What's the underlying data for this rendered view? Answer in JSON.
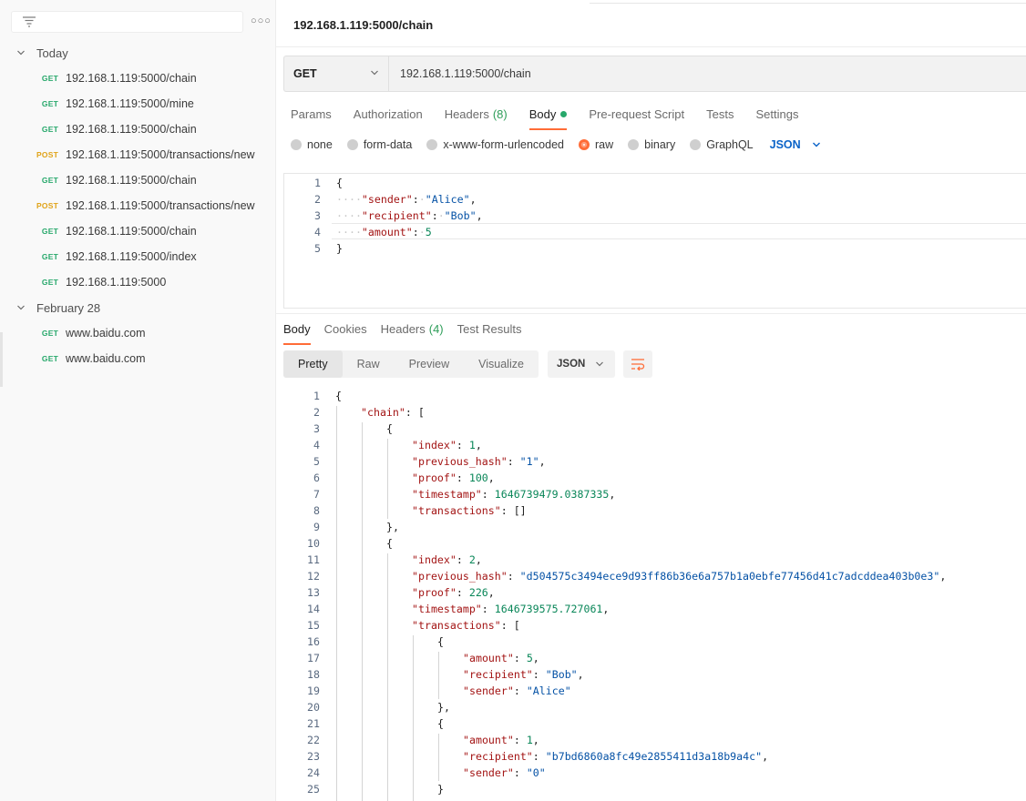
{
  "sidebar": {
    "groups": [
      {
        "label": "Today",
        "items": [
          {
            "method": "GET",
            "url": "192.168.1.119:5000/chain"
          },
          {
            "method": "GET",
            "url": "192.168.1.119:5000/mine"
          },
          {
            "method": "GET",
            "url": "192.168.1.119:5000/chain"
          },
          {
            "method": "POST",
            "url": "192.168.1.119:5000/transactions/new"
          },
          {
            "method": "GET",
            "url": "192.168.1.119:5000/chain"
          },
          {
            "method": "POST",
            "url": "192.168.1.119:5000/transactions/new"
          },
          {
            "method": "GET",
            "url": "192.168.1.119:5000/chain"
          },
          {
            "method": "GET",
            "url": "192.168.1.119:5000/index"
          },
          {
            "method": "GET",
            "url": "192.168.1.119:5000"
          }
        ]
      },
      {
        "label": "February 28",
        "items": [
          {
            "method": "GET",
            "url": "www.baidu.com"
          },
          {
            "method": "GET",
            "url": "www.baidu.com"
          }
        ]
      }
    ]
  },
  "request": {
    "title": "192.168.1.119:5000/chain",
    "method": "GET",
    "url": "192.168.1.119:5000/chain",
    "tabs": [
      {
        "label": "Params"
      },
      {
        "label": "Authorization"
      },
      {
        "label": "Headers",
        "count": "(8)"
      },
      {
        "label": "Body",
        "active": true,
        "dot": true
      },
      {
        "label": "Pre-request Script"
      },
      {
        "label": "Tests"
      },
      {
        "label": "Settings"
      }
    ],
    "body_types": [
      {
        "label": "none"
      },
      {
        "label": "form-data"
      },
      {
        "label": "x-www-form-urlencoded"
      },
      {
        "label": "raw",
        "selected": true
      },
      {
        "label": "binary"
      },
      {
        "label": "GraphQL"
      }
    ],
    "raw_format": "JSON",
    "body_lines": [
      [
        [
          "p",
          "{"
        ]
      ],
      [
        [
          "w",
          "····"
        ],
        [
          "k",
          "\"sender\""
        ],
        [
          "p",
          ":"
        ],
        [
          "w",
          "·"
        ],
        [
          "s",
          "\"Alice\""
        ],
        [
          "p",
          ","
        ]
      ],
      [
        [
          "w",
          "····"
        ],
        [
          "k",
          "\"recipient\""
        ],
        [
          "p",
          ":"
        ],
        [
          "w",
          "·"
        ],
        [
          "s",
          "\"Bob\""
        ],
        [
          "p",
          ","
        ]
      ],
      [
        [
          "w",
          "····"
        ],
        [
          "k",
          "\"amount\""
        ],
        [
          "p",
          ":"
        ],
        [
          "w",
          "·"
        ],
        [
          "n",
          "5"
        ]
      ],
      [
        [
          "p",
          "}"
        ]
      ]
    ]
  },
  "response": {
    "tabs": [
      {
        "label": "Body",
        "active": true
      },
      {
        "label": "Cookies"
      },
      {
        "label": "Headers",
        "count": "(4)"
      },
      {
        "label": "Test Results"
      }
    ],
    "views": [
      {
        "label": "Pretty",
        "active": true
      },
      {
        "label": "Raw"
      },
      {
        "label": "Preview"
      },
      {
        "label": "Visualize"
      }
    ],
    "format": "JSON",
    "lines": [
      {
        "indent": 0,
        "parts": [
          [
            "p",
            "{"
          ]
        ]
      },
      {
        "indent": 1,
        "parts": [
          [
            "k",
            "\"chain\""
          ],
          [
            "p",
            ": ["
          ]
        ]
      },
      {
        "indent": 2,
        "parts": [
          [
            "p",
            "{"
          ]
        ]
      },
      {
        "indent": 3,
        "parts": [
          [
            "k",
            "\"index\""
          ],
          [
            "p",
            ": "
          ],
          [
            "n",
            "1"
          ],
          [
            "p",
            ","
          ]
        ]
      },
      {
        "indent": 3,
        "parts": [
          [
            "k",
            "\"previous_hash\""
          ],
          [
            "p",
            ": "
          ],
          [
            "s",
            "\"1\""
          ],
          [
            "p",
            ","
          ]
        ]
      },
      {
        "indent": 3,
        "parts": [
          [
            "k",
            "\"proof\""
          ],
          [
            "p",
            ": "
          ],
          [
            "n",
            "100"
          ],
          [
            "p",
            ","
          ]
        ]
      },
      {
        "indent": 3,
        "parts": [
          [
            "k",
            "\"timestamp\""
          ],
          [
            "p",
            ": "
          ],
          [
            "n",
            "1646739479.0387335"
          ],
          [
            "p",
            ","
          ]
        ]
      },
      {
        "indent": 3,
        "parts": [
          [
            "k",
            "\"transactions\""
          ],
          [
            "p",
            ": []"
          ]
        ]
      },
      {
        "indent": 2,
        "parts": [
          [
            "p",
            "},"
          ]
        ]
      },
      {
        "indent": 2,
        "parts": [
          [
            "p",
            "{"
          ]
        ]
      },
      {
        "indent": 3,
        "parts": [
          [
            "k",
            "\"index\""
          ],
          [
            "p",
            ": "
          ],
          [
            "n",
            "2"
          ],
          [
            "p",
            ","
          ]
        ]
      },
      {
        "indent": 3,
        "parts": [
          [
            "k",
            "\"previous_hash\""
          ],
          [
            "p",
            ": "
          ],
          [
            "s",
            "\"d504575c3494ece9d93ff86b36e6a757b1a0ebfe77456d41c7adcddea403b0e3\""
          ],
          [
            "p",
            ","
          ]
        ]
      },
      {
        "indent": 3,
        "parts": [
          [
            "k",
            "\"proof\""
          ],
          [
            "p",
            ": "
          ],
          [
            "n",
            "226"
          ],
          [
            "p",
            ","
          ]
        ]
      },
      {
        "indent": 3,
        "parts": [
          [
            "k",
            "\"timestamp\""
          ],
          [
            "p",
            ": "
          ],
          [
            "n",
            "1646739575.727061"
          ],
          [
            "p",
            ","
          ]
        ]
      },
      {
        "indent": 3,
        "parts": [
          [
            "k",
            "\"transactions\""
          ],
          [
            "p",
            ": ["
          ]
        ]
      },
      {
        "indent": 4,
        "parts": [
          [
            "p",
            "{"
          ]
        ]
      },
      {
        "indent": 5,
        "parts": [
          [
            "k",
            "\"amount\""
          ],
          [
            "p",
            ": "
          ],
          [
            "n",
            "5"
          ],
          [
            "p",
            ","
          ]
        ]
      },
      {
        "indent": 5,
        "parts": [
          [
            "k",
            "\"recipient\""
          ],
          [
            "p",
            ": "
          ],
          [
            "s",
            "\"Bob\""
          ],
          [
            "p",
            ","
          ]
        ]
      },
      {
        "indent": 5,
        "parts": [
          [
            "k",
            "\"sender\""
          ],
          [
            "p",
            ": "
          ],
          [
            "s",
            "\"Alice\""
          ]
        ]
      },
      {
        "indent": 4,
        "parts": [
          [
            "p",
            "},"
          ]
        ]
      },
      {
        "indent": 4,
        "parts": [
          [
            "p",
            "{"
          ]
        ]
      },
      {
        "indent": 5,
        "parts": [
          [
            "k",
            "\"amount\""
          ],
          [
            "p",
            ": "
          ],
          [
            "n",
            "1"
          ],
          [
            "p",
            ","
          ]
        ]
      },
      {
        "indent": 5,
        "parts": [
          [
            "k",
            "\"recipient\""
          ],
          [
            "p",
            ": "
          ],
          [
            "s",
            "\"b7bd6860a8fc49e2855411d3a18b9a4c\""
          ],
          [
            "p",
            ","
          ]
        ]
      },
      {
        "indent": 5,
        "parts": [
          [
            "k",
            "\"sender\""
          ],
          [
            "p",
            ": "
          ],
          [
            "s",
            "\"0\""
          ]
        ]
      },
      {
        "indent": 4,
        "parts": [
          [
            "p",
            "}"
          ]
        ]
      }
    ]
  },
  "colors": {
    "get": "#27a86b",
    "post": "#e0a318",
    "accent": "#ff6c37",
    "link_blue": "#0a63c8",
    "json_key": "#a31515",
    "json_string": "#0451a5",
    "json_number": "#098658"
  }
}
